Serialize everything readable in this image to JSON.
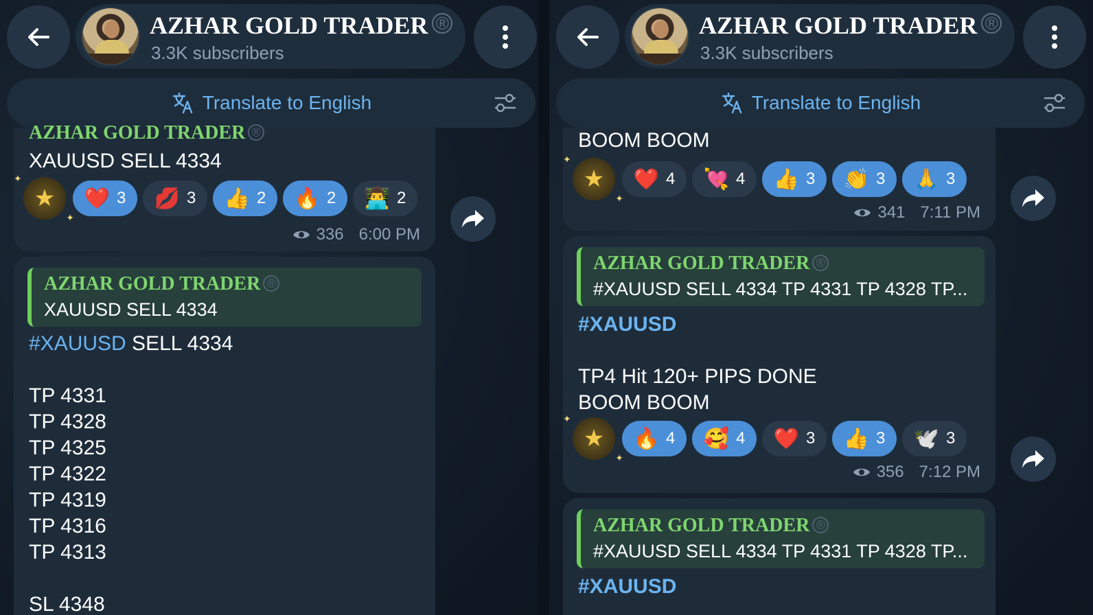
{
  "channel": {
    "title": "AZHAR GOLD TRADER",
    "subscribers": "3.3K subscribers",
    "registered_mark": "®"
  },
  "translate_bar": {
    "label": "Translate to English"
  },
  "left": {
    "msg1": {
      "sender": "AZHAR GOLD TRADER",
      "text": "XAUUSD SELL 4334",
      "reactions": [
        {
          "emoji": "❤️",
          "count": "3",
          "selected": true
        },
        {
          "emoji": "💋",
          "count": "3",
          "selected": false
        },
        {
          "emoji": "👍",
          "count": "2",
          "selected": true
        },
        {
          "emoji": "🔥",
          "count": "2",
          "selected": true
        },
        {
          "emoji": "👨‍💻",
          "count": "2",
          "selected": false
        }
      ],
      "views": "336",
      "time": "6:00 PM"
    },
    "msg2": {
      "quote_sender": "AZHAR GOLD TRADER",
      "quote_text": "XAUUSD SELL 4334",
      "hashtag": "#XAUUSD",
      "headline_rest": " SELL 4334",
      "lines": [
        "TP 4331",
        "TP 4328",
        "TP 4325",
        "TP 4322",
        "TP 4319",
        "TP 4316",
        "TP 4313"
      ],
      "sl": "SL 4348"
    }
  },
  "right": {
    "msg1": {
      "text": "BOOM BOOM",
      "reactions": [
        {
          "emoji": "❤️",
          "count": "4",
          "selected": false
        },
        {
          "emoji": "💘",
          "count": "4",
          "selected": false
        },
        {
          "emoji": "👍",
          "count": "3",
          "selected": true
        },
        {
          "emoji": "👏",
          "count": "3",
          "selected": true
        },
        {
          "emoji": "🙏",
          "count": "3",
          "selected": true
        }
      ],
      "views": "341",
      "time": "7:11 PM"
    },
    "msg2": {
      "quote_sender": "AZHAR GOLD TRADER",
      "quote_text": "#XAUUSD SELL 4334  TP 4331 TP 4328 TP...",
      "hashtag": "#XAUUSD",
      "line1": "TP4 Hit 120+ PIPS DONE",
      "line2": "BOOM BOOM",
      "reactions": [
        {
          "emoji": "🔥",
          "count": "4",
          "selected": true
        },
        {
          "emoji": "🥰",
          "count": "4",
          "selected": true
        },
        {
          "emoji": "❤️",
          "count": "3",
          "selected": false
        },
        {
          "emoji": "👍",
          "count": "3",
          "selected": true
        },
        {
          "emoji": "🕊️",
          "count": "3",
          "selected": false
        }
      ],
      "views": "356",
      "time": "7:12 PM"
    },
    "msg3": {
      "quote_sender": "AZHAR GOLD TRADER",
      "quote_text": "#XAUUSD SELL 4334  TP 4331 TP 4328 TP...",
      "hashtag": "#XAUUSD"
    }
  },
  "icons": {
    "back": "back-arrow-icon",
    "menu": "vertical-dots-icon",
    "translate": "translate-icon",
    "settings": "sliders-icon",
    "views": "eye-icon",
    "share": "share-arrow-icon",
    "star": "star-icon"
  },
  "colors": {
    "accent": "#6cb4f0",
    "sender_green": "#7fd66e",
    "bubble": "#1e2c3a",
    "selected_reaction": "#4b8fd8"
  }
}
